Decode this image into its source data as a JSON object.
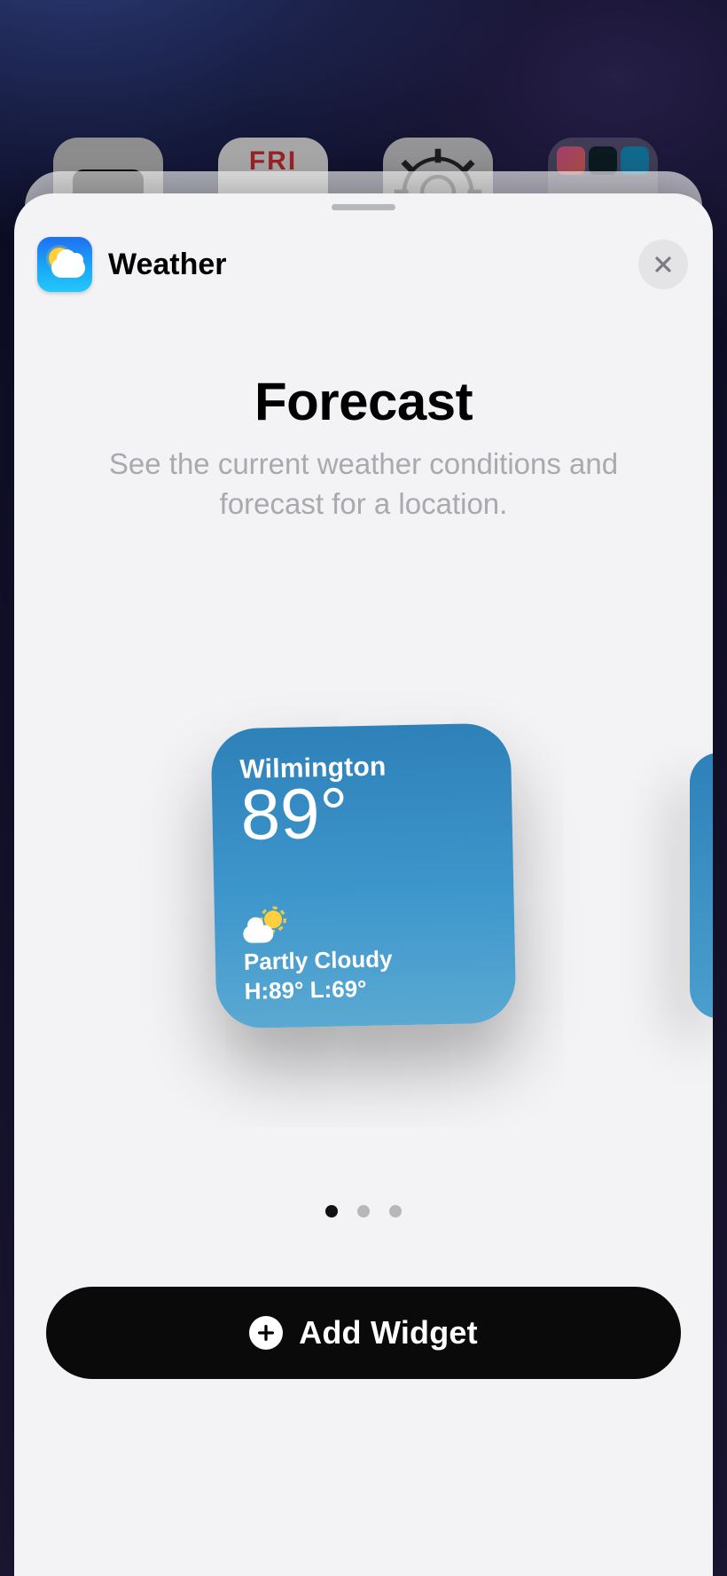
{
  "background": {
    "calendar_day_abbrev": "FRI"
  },
  "sheet": {
    "app_name": "Weather",
    "title": "Forecast",
    "subtitle": "See the current weather conditions and forecast for a location."
  },
  "widget_preview": {
    "location": "Wilmington",
    "temperature": "89°",
    "condition": "Partly Cloudy",
    "high_low": "H:89° L:69°",
    "icon": "partly-cloudy"
  },
  "pagination": {
    "count": 3,
    "active_index": 0
  },
  "cta": {
    "label": "Add Widget"
  }
}
